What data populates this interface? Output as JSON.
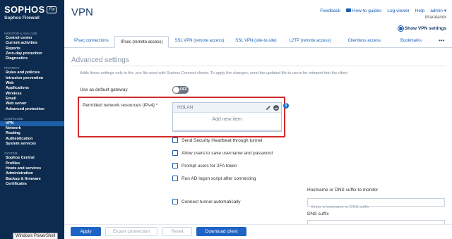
{
  "brand": {
    "name": "SOPHOS",
    "badge": "Fw",
    "product": "Sophos Firewall"
  },
  "sidebar": {
    "sections": [
      {
        "heading": "MONITOR & ANALYZE",
        "items": [
          "Control center",
          "Current activities",
          "Reports",
          "Zero-day protection",
          "Diagnostics"
        ]
      },
      {
        "heading": "PROTECT",
        "items": [
          "Rules and policies",
          "Intrusion prevention",
          "Web",
          "Applications",
          "Wireless",
          "Email",
          "Web server",
          "Advanced protection"
        ]
      },
      {
        "heading": "CONFIGURE",
        "items": [
          "VPN",
          "Network",
          "Routing",
          "Authentication",
          "System services"
        ]
      },
      {
        "heading": "SYSTEM",
        "items": [
          "Sophos Central",
          "Profiles",
          "Hosts and services",
          "Administration",
          "Backup & firmware",
          "Certificates"
        ]
      }
    ],
    "active": "VPN"
  },
  "header": {
    "title": "VPN",
    "links": {
      "feedback": "Feedback",
      "howto": "How-to guides",
      "log_viewer": "Log viewer",
      "help": "Help",
      "user": "admin"
    },
    "user_sub": "bharatandx",
    "show_settings": "Show VPN settings"
  },
  "tabs": [
    "IPsec connections",
    "IPsec (remote access)",
    "SSL VPN (remote access)",
    "SSL VPN (site-to-site)",
    "L2TP (remote access)",
    "Clientless access",
    "Bookmarks",
    "•••"
  ],
  "active_tab": "IPsec (remote access)",
  "advanced": {
    "title": "Advanced settings",
    "hint": "Adds these settings only to the .scx file used with Sophos Connect clients. To apply the changes, send the updated file to users for reimport into the client",
    "default_gateway_label": "Use as default gateway",
    "toggle_text": "OFF",
    "network_resources_label": "Permitted network resources (IPv4) *",
    "network_resources": [
      "HOLAN"
    ],
    "add_new_item": "Add new item",
    "checkboxes": [
      "Send Security Heartbeat through tunnel",
      "Allow users to save username and password",
      "Prompt users for 2FA token",
      "Run AD logon script after connecting",
      "Connect tunnel automatically"
    ],
    "hostname_label": "Hostname or DNS suffix to monitor",
    "hostname_placeholder": "Enter a hostname or DNS suffix",
    "dns_suffix_label": "DNS suffix"
  },
  "footer": {
    "apply": "Apply",
    "export": "Export connection",
    "reset": "Reset",
    "download": "Download client",
    "tooltip": "Windows PowerShell"
  }
}
